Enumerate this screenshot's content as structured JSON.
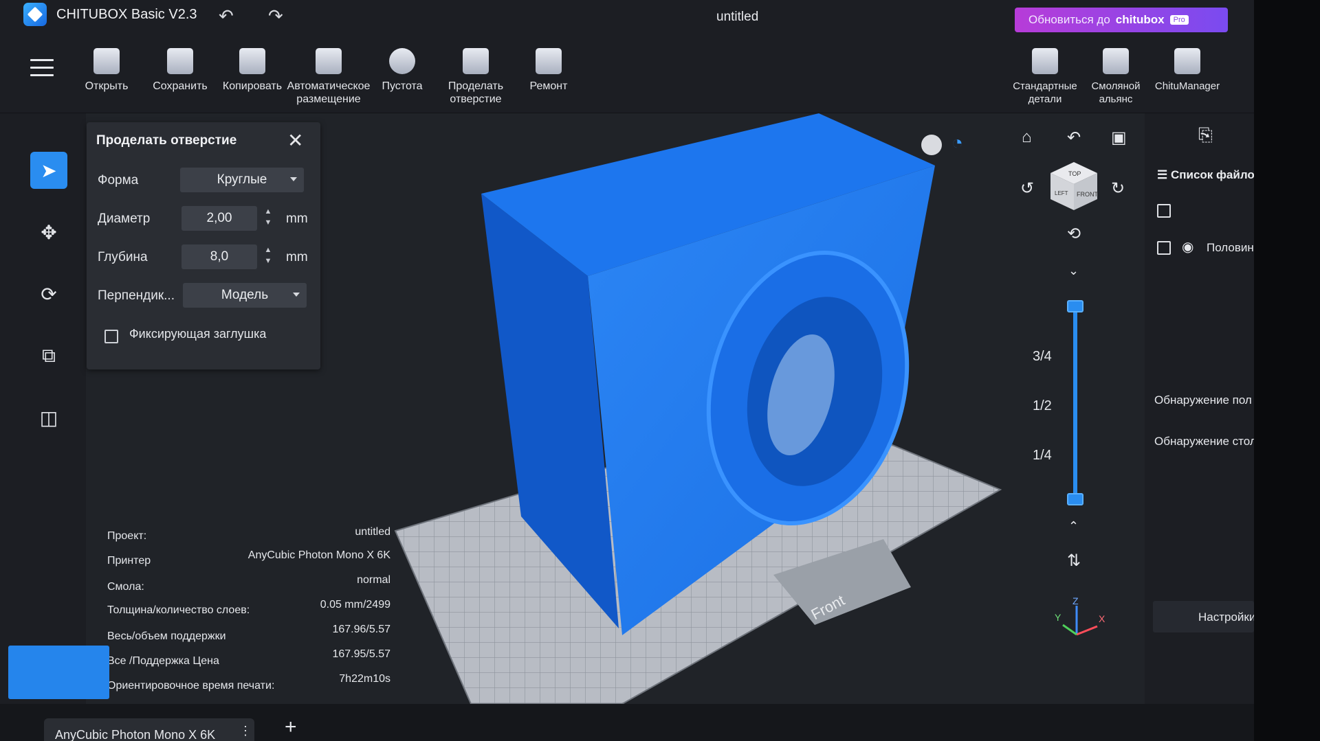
{
  "app": {
    "title": "CHITUBOX Basic V2.3",
    "document_title": "untitled",
    "upgrade_text": "Обновиться до",
    "upgrade_brand": "chitubox",
    "upgrade_badge": "Pro"
  },
  "toolbar": {
    "tools": [
      {
        "label": "Открыть",
        "icon": "folder-icon"
      },
      {
        "label": "Сохранить",
        "icon": "save-icon"
      },
      {
        "label": "Копировать",
        "icon": "copy-icon"
      },
      {
        "label": "Автоматическое размещение",
        "icon": "auto-layout-icon"
      },
      {
        "label": "Пустота",
        "icon": "hollow-icon"
      },
      {
        "label": "Проделать отверстие",
        "icon": "dig-hole-icon"
      },
      {
        "label": "Ремонт",
        "icon": "repair-icon"
      }
    ],
    "right_tools": [
      {
        "label": "Стандартные детали",
        "icon": "standard-parts-icon"
      },
      {
        "label": "Смоляной альянс",
        "icon": "resin-alliance-icon"
      },
      {
        "label": "ChituManager",
        "icon": "chitumanager-icon"
      }
    ]
  },
  "hole_dialog": {
    "title": "Проделать отверстие",
    "shape_label": "Форма",
    "shape_value": "Круглые",
    "diameter_label": "Диаметр",
    "diameter_value": "2,00",
    "diameter_unit": "mm",
    "depth_label": "Глубина",
    "depth_value": "8,0",
    "depth_unit": "mm",
    "perpendicular_label": "Перпендик...",
    "perpendicular_value": "Модель",
    "plug_label": "Фиксирующая заглушка"
  },
  "project_info": [
    {
      "label": "Проект:",
      "value": "untitled"
    },
    {
      "label": "Принтер",
      "value": "AnyCubic Photon Mono X 6K"
    },
    {
      "label": "Смола:",
      "value": "normal"
    },
    {
      "label": "Толщина/количество слоев:",
      "value": "0.05 mm/2499"
    },
    {
      "label": "Весь/объем поддержки",
      "value": "167.96/5.57"
    },
    {
      "label": "Все /Поддержка Цена",
      "value": "167.95/5.57"
    },
    {
      "label": "Ориентировочное время печати:",
      "value": "7h22m10s"
    }
  ],
  "view_cube": {
    "top": "TOP",
    "left": "LEFT",
    "front": "FRONT"
  },
  "slice_slider": {
    "fractions": [
      "3/4",
      "1/2",
      "1/4"
    ]
  },
  "axes": {
    "x": "X",
    "y": "Y",
    "z": "Z"
  },
  "plate_label": "Front",
  "right_panel": {
    "file_list": "Список файлов",
    "item_name": "Половин",
    "detect_1": "Обнаружение пол",
    "detect_2": "Обнаружение стол",
    "settings_btn": "Настройки"
  },
  "bottom_tab": {
    "label": "AnyCubic Photon Mono X 6K",
    "more": "⋮",
    "add": "+"
  },
  "colors": {
    "accent": "#2a8df0",
    "model": "#1f78ea",
    "upgrade": "#9b45e0"
  }
}
